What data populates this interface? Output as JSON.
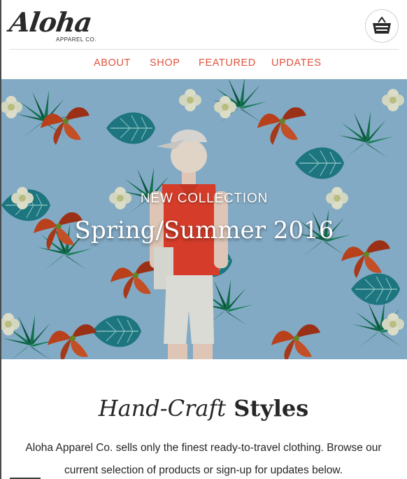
{
  "brand": {
    "logo_text": "Aloha",
    "logo_subtext": "APPAREL CO."
  },
  "header": {
    "cart_icon": "shopping-basket-icon"
  },
  "nav": {
    "items": [
      {
        "label": "ABOUT"
      },
      {
        "label": "SHOP"
      },
      {
        "label": "FEATURED"
      },
      {
        "label": "UPDATES"
      }
    ]
  },
  "hero": {
    "eyebrow": "NEW COLLECTION",
    "title": "Spring/Summer 2016"
  },
  "intro": {
    "heading_italic": "Hand-Craft",
    "heading_bold": "Styles",
    "body": "Aloha Apparel Co. sells only the finest ready-to-travel clothing. Browse our current selection of products or sign-up for updates below."
  },
  "colors": {
    "accent": "#e0533e",
    "text": "#262626",
    "hero_background": "#8fb9d6"
  }
}
